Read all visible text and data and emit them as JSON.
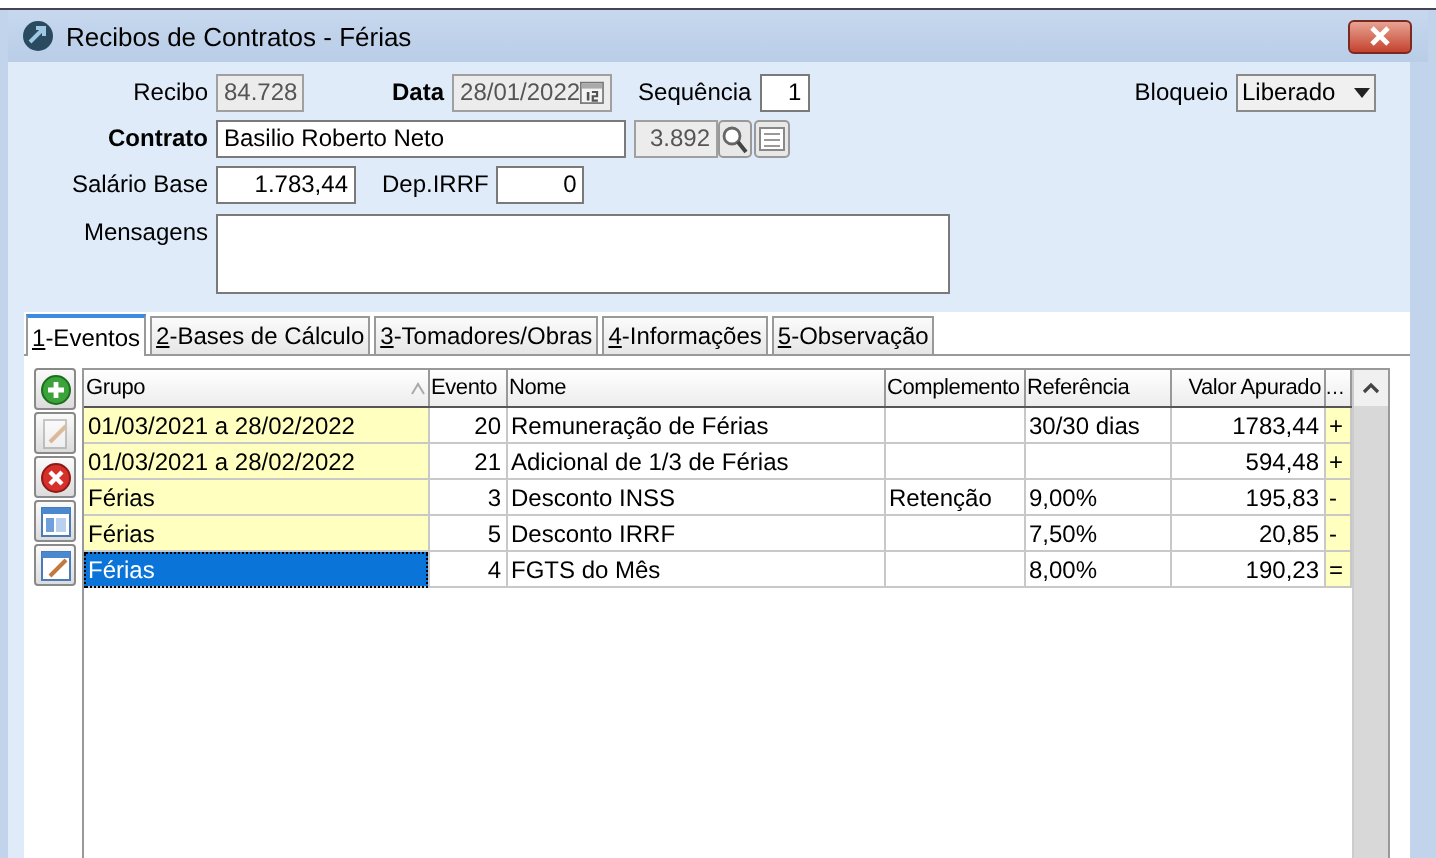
{
  "window": {
    "title": "Recibos de Contratos - Férias"
  },
  "form": {
    "recibo": {
      "label": "Recibo",
      "value": "84.728",
      "disabled": true
    },
    "data": {
      "label": "Data",
      "value": "28/01/2022",
      "disabled": true
    },
    "sequencia": {
      "label": "Sequência",
      "value": "1",
      "disabled": false
    },
    "bloqueio": {
      "label": "Bloqueio",
      "value": "Liberado"
    },
    "contrato": {
      "label": "Contrato",
      "value": "Basilio Roberto Neto",
      "code": "3.892",
      "disabled": false
    },
    "salario_base": {
      "label": "Salário Base",
      "value": "1.783,44",
      "disabled": false
    },
    "dep_irrf": {
      "label": "Dep.IRRF",
      "value": "0",
      "disabled": false
    },
    "mensagens": {
      "label": "Mensagens"
    }
  },
  "tabs": [
    {
      "label": "1-Eventos",
      "selected": true
    },
    {
      "label": "2-Bases de Cálculo",
      "selected": false
    },
    {
      "label": "3-Tomadores/Obras",
      "selected": false
    },
    {
      "label": "4-Informações",
      "selected": false
    },
    {
      "label": "5-Observação",
      "selected": false
    }
  ],
  "tools": [
    {
      "kind": "add",
      "disabled": false
    },
    {
      "kind": "edit",
      "disabled": true
    },
    {
      "kind": "delete",
      "disabled": false
    },
    {
      "kind": "layout",
      "disabled": false
    },
    {
      "kind": "modify",
      "disabled": false
    }
  ],
  "table": {
    "columns": [
      "Grupo",
      "Evento",
      "Nome",
      "Complemento",
      "Referência",
      "Valor Apurado",
      "…"
    ],
    "rows": [
      {
        "grupo": "01/03/2021 a 28/02/2022",
        "evento": "20",
        "nome": "Remuneração de Férias",
        "complemento": "",
        "referencia": "30/30 dias",
        "valor": "1783,44",
        "sinal": "+",
        "selected": false
      },
      {
        "grupo": "01/03/2021 a 28/02/2022",
        "evento": "21",
        "nome": "Adicional de 1/3 de Férias",
        "complemento": "",
        "referencia": "",
        "valor": "594,48",
        "sinal": "+",
        "selected": false
      },
      {
        "grupo": "Férias",
        "evento": "3",
        "nome": "Desconto INSS",
        "complemento": "Retenção",
        "referencia": "9,00%",
        "valor": "195,83",
        "sinal": "-",
        "selected": false
      },
      {
        "grupo": "Férias",
        "evento": "5",
        "nome": "Desconto IRRF",
        "complemento": "",
        "referencia": "7,50%",
        "valor": "20,85",
        "sinal": "-",
        "selected": false
      },
      {
        "grupo": "Férias",
        "evento": "4",
        "nome": "FGTS do Mês",
        "complemento": "",
        "referencia": "8,00%",
        "valor": "190,23",
        "sinal": "=",
        "selected": true
      }
    ]
  }
}
